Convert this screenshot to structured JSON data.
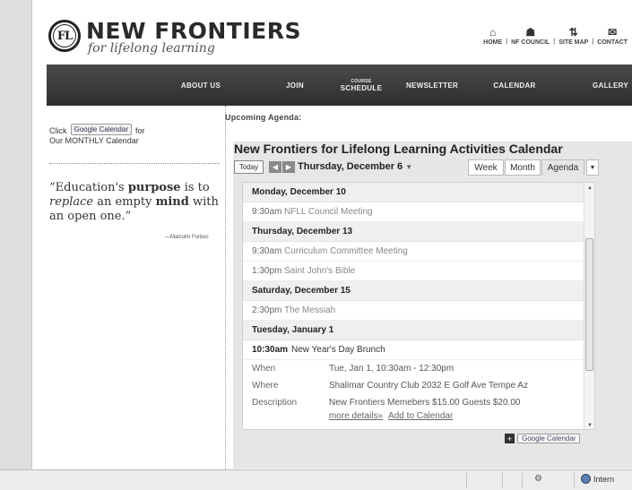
{
  "header": {
    "logo_letters": "FL",
    "title": "NEW FRONTIERS",
    "tagline": "for lifelong learning",
    "top_links": [
      {
        "icon": "home-icon",
        "label": "HOME"
      },
      {
        "icon": "council-icon",
        "label": "NF COUNCIL"
      },
      {
        "icon": "sitemap-icon",
        "label": "SITE MAP"
      },
      {
        "icon": "contact-icon",
        "label": "CONTACT"
      }
    ]
  },
  "nav": {
    "items": [
      {
        "label": "ABOUT US",
        "sup": ""
      },
      {
        "label": "JOIN",
        "sup": ""
      },
      {
        "label": "SCHEDULE",
        "sup": "COURSE"
      },
      {
        "label": "NEWSLETTER",
        "sup": ""
      },
      {
        "label": "CALENDAR",
        "sup": ""
      },
      {
        "label": "GALLERY",
        "sup": ""
      }
    ]
  },
  "sidebar": {
    "click_text": "Click",
    "gcal_label": "Google Calendar",
    "for_text": "for",
    "monthly_text": "Our MONTHLY Calendar",
    "quote_open": "“Education's ",
    "quote_b1": "purpose",
    "quote_mid1": " is to ",
    "quote_i": "replace",
    "quote_mid2": " an empty ",
    "quote_b2": "mind",
    "quote_end": " with an open one.”",
    "quote_author": "—Malcolm Forbes"
  },
  "main": {
    "upcoming_label": "Upcoming Agenda:",
    "calendar": {
      "title": "New Frontiers for Lifelong Learning Activities Calendar",
      "today_label": "Today",
      "current_date": "Thursday, December 6",
      "views": [
        "Week",
        "Month",
        "Agenda"
      ],
      "days": [
        {
          "date": "Monday, December 10",
          "events": [
            {
              "time": "9:30am",
              "title": "NFLL Council Meeting"
            }
          ]
        },
        {
          "date": "Thursday, December 13",
          "events": [
            {
              "time": "9:30am",
              "title": "Curriculum Committee Meeting"
            },
            {
              "time": "1:30pm",
              "title": "Saint John's Bible"
            }
          ]
        },
        {
          "date": "Saturday, December 15",
          "events": [
            {
              "time": "2:30pm",
              "title": "The Messiah"
            }
          ]
        },
        {
          "date": "Tuesday, January 1",
          "events": []
        }
      ],
      "open_event": {
        "time": "10:30am",
        "title": "New Year's Day Brunch",
        "when_label": "When",
        "when_value": "Tue, Jan 1, 10:30am - 12:30pm",
        "where_label": "Where",
        "where_value": "Shalimar Country Club 2032 E Golf Ave Tempe Az",
        "desc_label": "Description",
        "desc_value": "New Frontiers Memebers $15.00 Guests $20.00",
        "more_details": "more details»",
        "add_to_calendar": "Add to Calendar"
      },
      "google_badge": "Google Calendar"
    }
  },
  "statusbar": {
    "zone_label": "Intern"
  },
  "colors": {
    "nav_bg": "#3a3a3a",
    "panel_bg": "#e6e6e6",
    "day_head_bg": "#efefef"
  }
}
